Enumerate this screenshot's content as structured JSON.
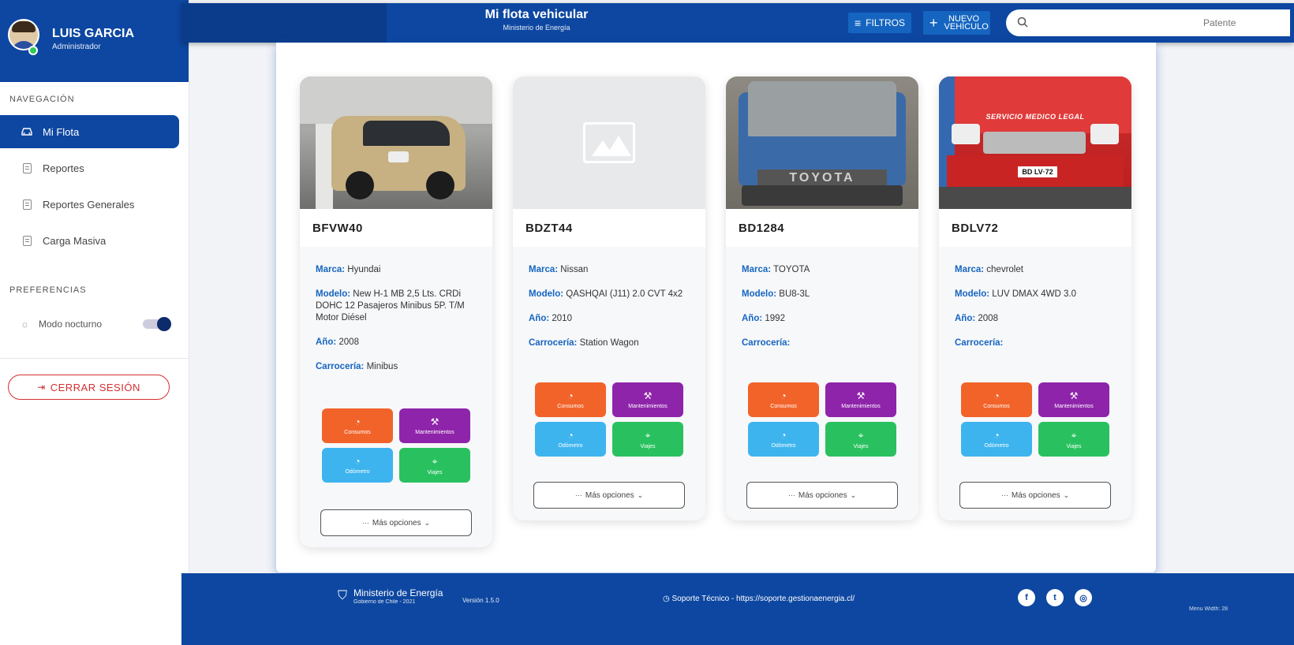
{
  "user": {
    "name": "LUIS GARCIA",
    "role": "Administrador"
  },
  "sidebar": {
    "nav_title": "NAVEGACIÓN",
    "items": [
      {
        "label": "Mi Flota"
      },
      {
        "label": "Reportes"
      },
      {
        "label": "Reportes Generales"
      },
      {
        "label": "Carga Masiva"
      }
    ],
    "pref_title": "PREFERENCIAS",
    "dark_mode_label": "Modo nocturno",
    "logout_label": "CERRAR SESIÓN"
  },
  "header": {
    "title": "Mi flota vehicular",
    "subtitle": "Ministerio de Energía",
    "filters_label": "FILTROS",
    "new_label_1": "NUEVO",
    "new_label_2": "VEHÍCULO",
    "search_placeholder": "Patente"
  },
  "labels": {
    "marca": "Marca:",
    "modelo": "Modelo:",
    "anio": "Año:",
    "carroceria": "Carrocería:",
    "consumos": "Consumos",
    "mantenimientos": "Mantenimientos",
    "odometro": "Odómetro",
    "viajes": "Viajes",
    "mas_opciones": "Más opciones"
  },
  "vehicles": [
    {
      "plate": "BFVW40",
      "marca": "Hyundai",
      "modelo": "New H-1 MB 2,5 Lts. CRDi DOHC 12 Pasajeros Minibus 5P. T/M Motor Diésel",
      "anio": "2008",
      "carroceria": "Minibus"
    },
    {
      "plate": "BDZT44",
      "marca": "Nissan",
      "modelo": "QASHQAI (J11) 2.0 CVT 4x2",
      "anio": "2010",
      "carroceria": "Station Wagon"
    },
    {
      "plate": "BD1284",
      "marca": "TOYOTA",
      "modelo": "BU8-3L",
      "anio": "1992",
      "carroceria": "",
      "photo_text": "TOYOTA"
    },
    {
      "plate": "BDLV72",
      "marca": "chevrolet",
      "modelo": "LUV DMAX 4WD 3.0",
      "anio": "2008",
      "carroceria": "",
      "photo_text": "SERVICIO MEDICO LEGAL",
      "photo_plate": "BD LV·72"
    }
  ],
  "footer": {
    "org_name": "Ministerio de Energía",
    "org_sub": "Gobierno de Chile - 2021",
    "version": "Versión 1.5.0",
    "support": "Soporte Técnico - https://soporte.gestionaenergia.cl/",
    "menu_width": "Menu Width: 28"
  },
  "colors": {
    "primary": "#0d47a1",
    "consumos": "#f2632a",
    "mantenimientos": "#8e24aa",
    "odometro": "#3db4ee",
    "viajes": "#29c15f",
    "logout": "#d32f2f"
  }
}
